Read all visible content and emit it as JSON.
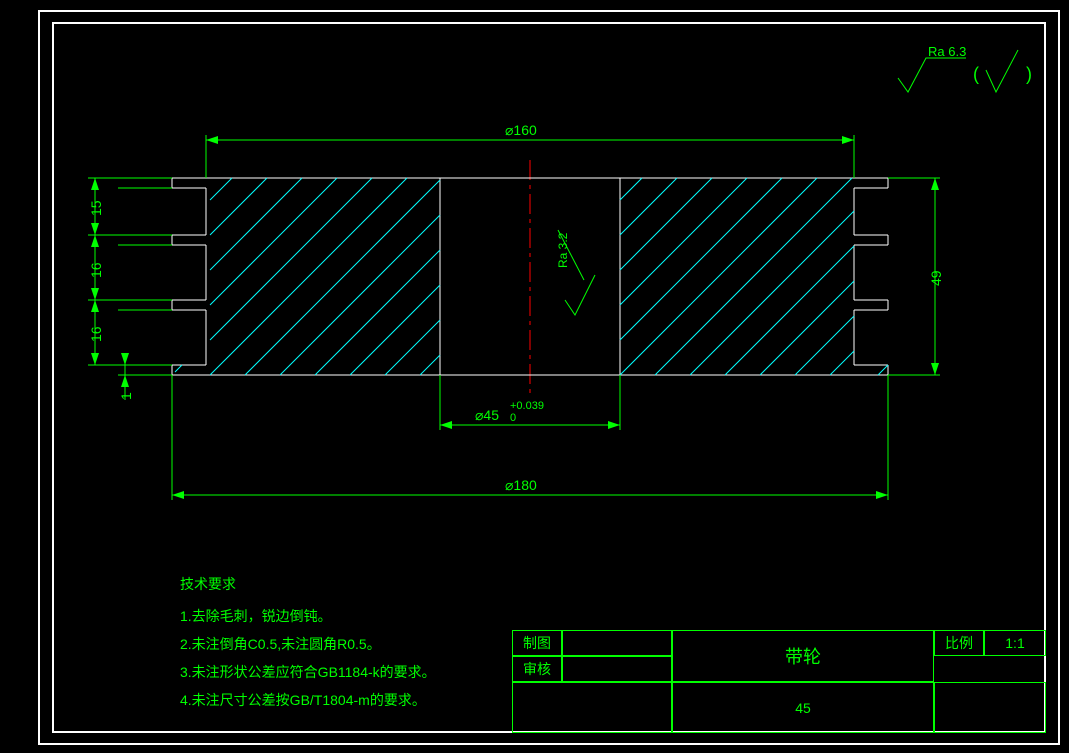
{
  "surface_finish": {
    "top_label": "Ra 6.3",
    "paren_open": "(",
    "paren_close": ")"
  },
  "dimensions": {
    "d160": "⌀160",
    "d180": "⌀180",
    "d45": "⌀45",
    "d45_tol_upper": "+0.039",
    "d45_tol_lower": "0",
    "h49": "49",
    "v15": "15",
    "v16a": "16",
    "v16b": "16",
    "v1": "1",
    "ra32": "Ra 3.2"
  },
  "tech_requirements": {
    "title": "技术要求",
    "items": [
      "1.去除毛刺，锐边倒钝。",
      "2.未注倒角C0.5,未注圆角R0.5。",
      "3.未注形状公差应符合GB1184-k的要求。",
      "4.未注尺寸公差按GB/T1804-m的要求。"
    ]
  },
  "title_block": {
    "drawn_by_label": "制图",
    "checked_by_label": "审核",
    "part_name": "带轮",
    "material": "45",
    "scale_label": "比例",
    "scale_value": "1:1"
  }
}
